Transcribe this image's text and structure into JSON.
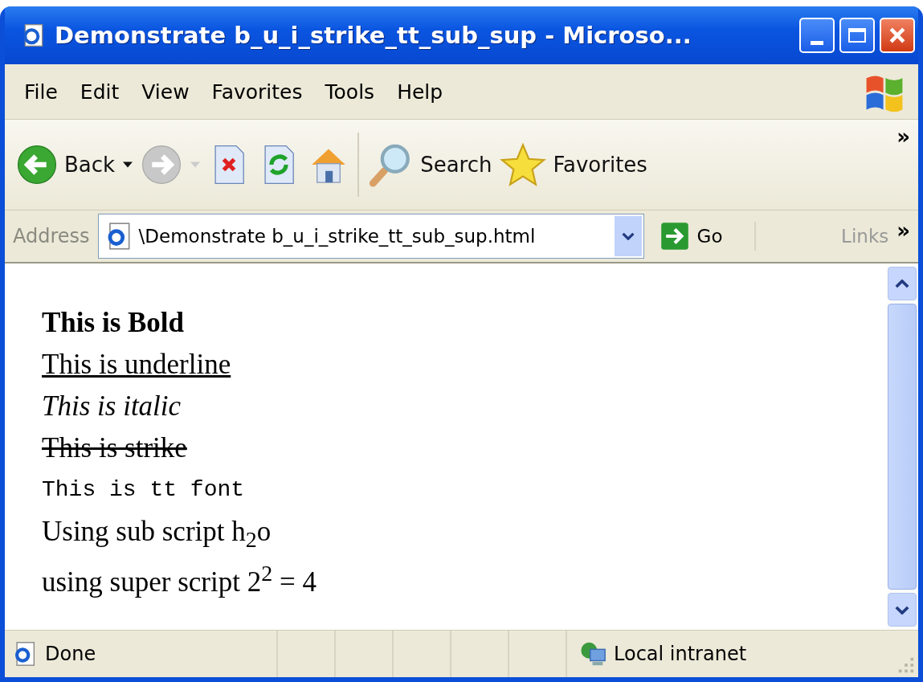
{
  "window": {
    "title": "Demonstrate b_u_i_strike_tt_sub_sup - Microso..."
  },
  "menu": [
    "File",
    "Edit",
    "View",
    "Favorites",
    "Tools",
    "Help"
  ],
  "toolbar": {
    "back": "Back",
    "search": "Search",
    "favorites": "Favorites",
    "more": "»"
  },
  "address": {
    "label": "Address",
    "value": "\\Demonstrate b_u_i_strike_tt_sub_sup.html",
    "go": "Go",
    "links": "Links",
    "more": "»"
  },
  "content": [
    {
      "kind": "bold",
      "text": "This is Bold"
    },
    {
      "kind": "underline",
      "text": "This is underline"
    },
    {
      "kind": "italic",
      "text": "This is italic"
    },
    {
      "kind": "strike",
      "text": "This is strike"
    },
    {
      "kind": "tt",
      "text": "This is tt font"
    },
    {
      "kind": "plain",
      "text": "Using sub script h$_{2}$o"
    },
    {
      "kind": "plain",
      "text": "using super script 2$^{2}$ = 4"
    }
  ],
  "status": {
    "text": "Done",
    "zone": "Local intranet"
  }
}
